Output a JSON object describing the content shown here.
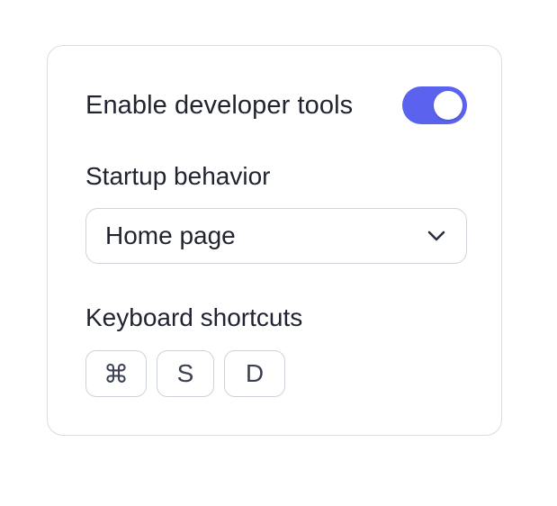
{
  "settings": {
    "dev_tools_label": "Enable developer tools",
    "dev_tools_enabled": true,
    "startup_label": "Startup behavior",
    "startup_value": "Home page",
    "shortcuts_label": "Keyboard shortcuts",
    "shortcut_keys": [
      "⌘",
      "S",
      "D"
    ]
  },
  "icons": {
    "toggle": "toggle-switch-on",
    "select": "chevron-down-icon",
    "key_1": "command-icon",
    "key_2": "stylized-s-key",
    "key_3": "letter-d-key"
  },
  "colors": {
    "accent": "#5b63ee",
    "text": "#1f2430",
    "border": "#d9dde4"
  }
}
